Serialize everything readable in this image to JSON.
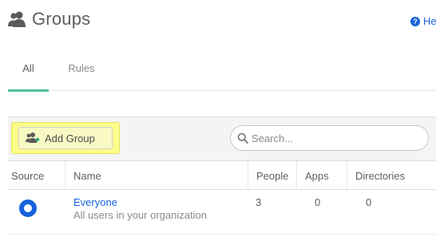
{
  "header": {
    "title": "Groups",
    "help_label": "Help"
  },
  "tabs": [
    {
      "label": "All",
      "active": true
    },
    {
      "label": "Rules",
      "active": false
    }
  ],
  "toolbar": {
    "add_group_label": "Add Group",
    "search_placeholder": "Search..."
  },
  "table": {
    "columns": [
      "Source",
      "Name",
      "People",
      "Apps",
      "Directories"
    ],
    "rows": [
      {
        "source_icon": "okta-circle-icon",
        "name": "Everyone",
        "description": "All users in your organization",
        "people": "3",
        "apps": "0",
        "directories": "0"
      }
    ]
  },
  "colors": {
    "accent_blue": "#1662dd",
    "tab_underline": "#4cbf9c",
    "highlight_yellow": "#fdfd8a"
  },
  "icons": {
    "title_icon": "groups-icon",
    "help_icon": "help-icon",
    "add_icon": "add-group-icon",
    "search_icon": "search-icon"
  }
}
